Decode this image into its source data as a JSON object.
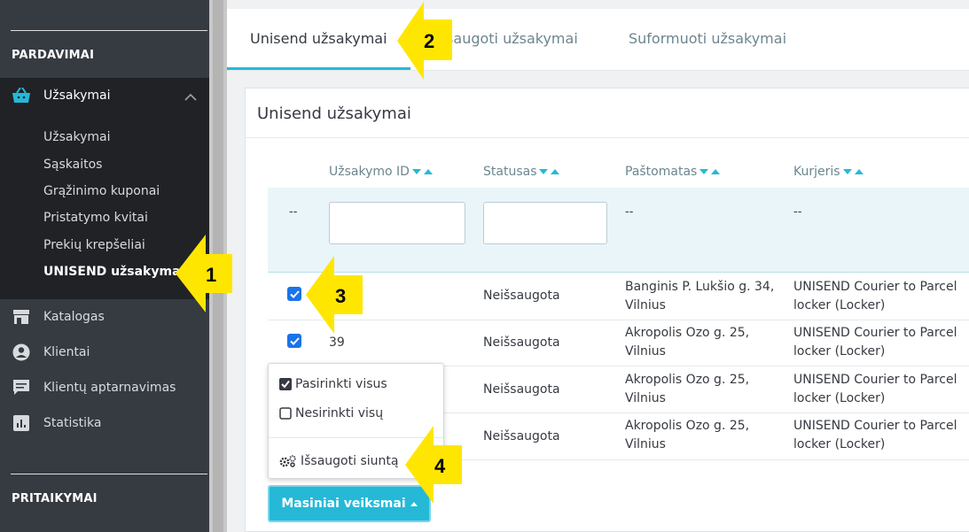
{
  "sidebar": {
    "section_sales": "PARDAVIMAI",
    "orders_label": "Užsakymai",
    "sub_items": [
      "Užsakymai",
      "Sąskaitos",
      "Grąžinimo kuponai",
      "Pristatymo kvitai",
      "Prekių krepšeliai",
      "UNISEND užsakymai"
    ],
    "items": [
      "Katalogas",
      "Klientai",
      "Klientų aptarnavimas",
      "Statistika"
    ],
    "section_custom": "PRITAIKYMAI"
  },
  "tabs": [
    "Unisend užsakymai",
    "Išsaugoti užsakymai",
    "Suformuoti užsakymai"
  ],
  "panel": {
    "title": "Unisend užsakymai",
    "columns": [
      "Užsakymo ID",
      "Statusas",
      "Paštomatas",
      "Kurjeris"
    ],
    "filter_dash": "--",
    "rows": [
      {
        "id": "",
        "status": "Neišsaugota",
        "locker": [
          "Banginis P. Lukšio g. 34,",
          "Vilnius"
        ],
        "courier": [
          "UNISEND Courier to Parcel",
          "locker (Locker)"
        ]
      },
      {
        "id": "39",
        "status": "Neišsaugota",
        "locker": [
          "Akropolis Ozo g. 25,",
          "Vilnius"
        ],
        "courier": [
          "UNISEND Courier to Parcel",
          "locker (Locker)"
        ]
      },
      {
        "id": "",
        "status": "Neišsaugota",
        "locker": [
          "Akropolis Ozo g. 25,",
          "Vilnius"
        ],
        "courier": [
          "UNISEND Courier to Parcel",
          "locker (Locker)"
        ]
      },
      {
        "id": "",
        "status": "Neišsaugota",
        "locker": [
          "Akropolis Ozo g. 25,",
          "Vilnius"
        ],
        "courier": [
          "UNISEND Courier to Parcel",
          "locker (Locker)"
        ]
      }
    ]
  },
  "dropdown": {
    "select_all": "Pasirinkti visus",
    "deselect_all": "Nesirinkti visų",
    "save_shipment": "Išsaugoti siuntą"
  },
  "bulk_button": "Masiniai veiksmai",
  "annotations": [
    "1",
    "2",
    "3",
    "4"
  ],
  "colors": {
    "accent": "#25b9d7",
    "sidebar": "#363a41",
    "arrow": "#ffe600",
    "checkbox": "#1a73e8"
  }
}
